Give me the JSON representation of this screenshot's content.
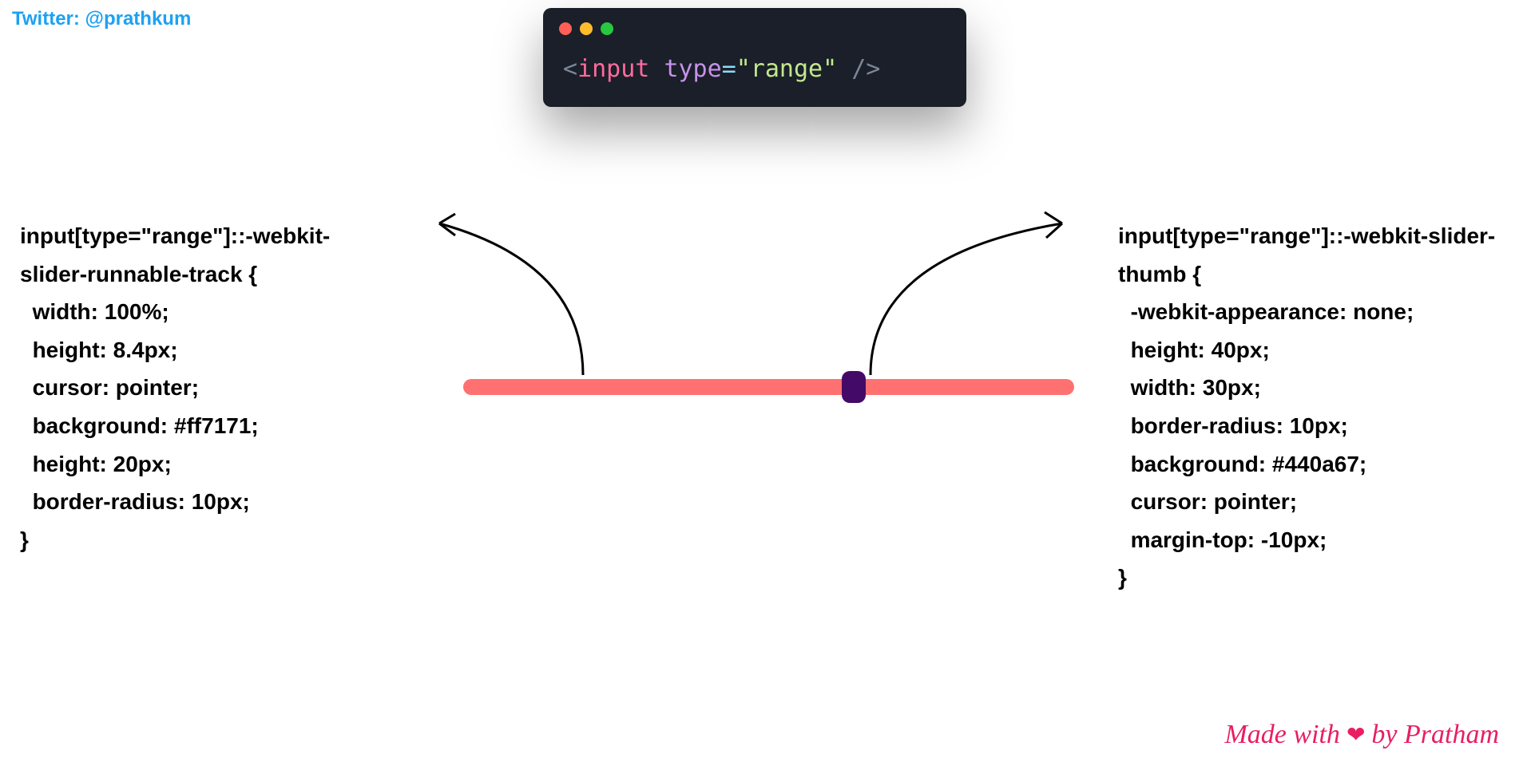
{
  "twitter": "Twitter: @prathkum",
  "code": {
    "bracket_open": "<",
    "tag": "input",
    "attr": "type",
    "eq": "=",
    "string": "\"range\"",
    "bracket_close": " />"
  },
  "css_track": "input[type=\"range\"]::-webkit-slider-runnable-track {\n  width: 100%;\n  height: 8.4px;\n  cursor: pointer;\n  background: #ff7171;\n  height: 20px;\n  border-radius: 10px;\n}",
  "css_thumb": "input[type=\"range\"]::-webkit-slider-thumb {\n  -webkit-appearance: none;\n  height: 40px;\n  width: 30px;\n  border-radius: 10px;\n  background: #440a67;\n  cursor: pointer;\n  margin-top: -10px;\n}",
  "footer": {
    "prefix": "Made with",
    "suffix": "by Pratham"
  },
  "slider": {
    "track_color": "#ff7171",
    "thumb_color": "#440a67"
  }
}
